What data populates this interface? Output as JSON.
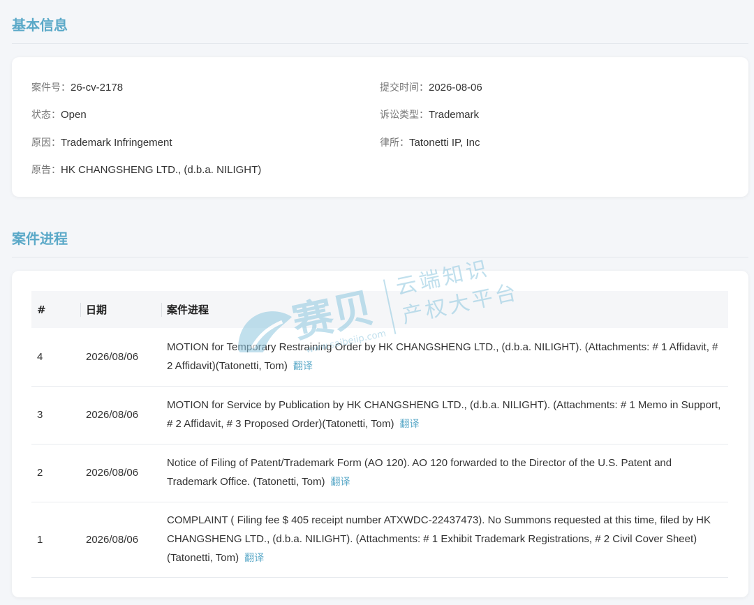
{
  "basic_info": {
    "title": "基本信息",
    "fields": [
      {
        "key": "案件号：",
        "value": "26-cv-2178"
      },
      {
        "key": "提交时间：",
        "value": "2026-08-06"
      },
      {
        "key": "状态：",
        "value": "Open"
      },
      {
        "key": "诉讼类型：",
        "value": "Trademark"
      },
      {
        "key": "原因：",
        "value": "Trademark Infringement"
      },
      {
        "key": "律所：",
        "value": "Tatonetti IP, Inc"
      },
      {
        "key": "原告：",
        "value": "HK CHANGSHENG LTD., (d.b.a. NILIGHT)"
      }
    ]
  },
  "progress": {
    "title": "案件进程",
    "headers": {
      "num": "#",
      "date": "日期",
      "desc": "案件进程"
    },
    "translate_label": "翻译",
    "rows": [
      {
        "num": "4",
        "date": "2026/08/06",
        "desc": "MOTION for Temporary Restraining Order by HK CHANGSHENG LTD., (d.b.a. NILIGHT). (Attachments: # 1 Affidavit, # 2 Affidavit)(Tatonetti, Tom)"
      },
      {
        "num": "3",
        "date": "2026/08/06",
        "desc": "MOTION for Service by Publication by HK CHANGSHENG LTD., (d.b.a. NILIGHT). (Attachments: # 1 Memo in Support, # 2 Affidavit, # 3 Proposed Order)(Tatonetti, Tom)"
      },
      {
        "num": "2",
        "date": "2026/08/06",
        "desc": "Notice of Filing of Patent/Trademark Form (AO 120). AO 120 forwarded to the Director of the U.S. Patent and Trademark Office. (Tatonetti, Tom)"
      },
      {
        "num": "1",
        "date": "2026/08/06",
        "desc": "COMPLAINT ( Filing fee $ 405 receipt number ATXWDC-22437473). No Summons requested at this time, filed by HK CHANGSHENG LTD., (d.b.a. NILIGHT). (Attachments: # 1 Exhibit Trademark Registrations, # 2 Civil Cover Sheet)(Tatonetti, Tom)"
      }
    ]
  },
  "watermark": {
    "brand": "赛贝",
    "url": "www.saibeiip.com",
    "slogan1": "云端知识",
    "slogan2": "产权大平台"
  },
  "colors": {
    "accent": "#5ba9c8"
  }
}
